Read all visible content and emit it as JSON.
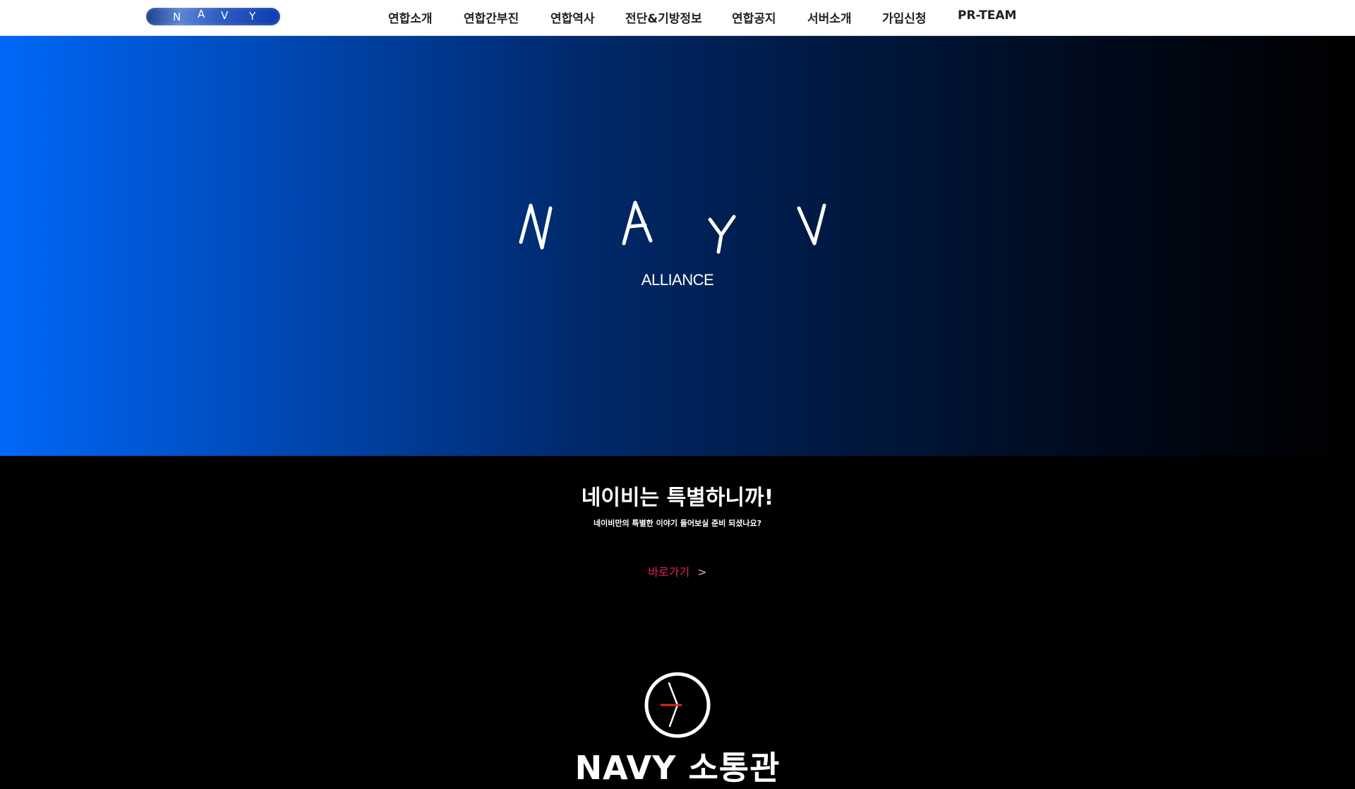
{
  "header": {
    "logo": {
      "letters": [
        "N",
        "A",
        "V",
        "Y"
      ],
      "colors": {
        "pill_start": "#1d3f8f",
        "pill_end": "#0c3db0"
      }
    },
    "nav": [
      {
        "label": "연합소개"
      },
      {
        "label": "연합간부진"
      },
      {
        "label": "연합역사"
      },
      {
        "label": "전단&기방정보"
      },
      {
        "label": "연합공지"
      },
      {
        "label": "서버소개"
      },
      {
        "label": "가입신청"
      },
      {
        "label": "PR-TEAM"
      }
    ]
  },
  "hero": {
    "letters": [
      "N",
      "A",
      "Y",
      "V"
    ],
    "subtitle": "ALLIANCE",
    "colors": {
      "gradient_start": "#0068f8",
      "gradient_end": "#000000"
    }
  },
  "intro": {
    "title": "네이비는 특별하니까!",
    "description": "네이비만의 특별한 이야기 들어보실 준비 되셨나요?",
    "link_label": "바로가기",
    "link_arrow": ">",
    "link_color": "#e0245a"
  },
  "next_section": {
    "icon": "clock-icon",
    "title": "NAVY 소통관"
  }
}
